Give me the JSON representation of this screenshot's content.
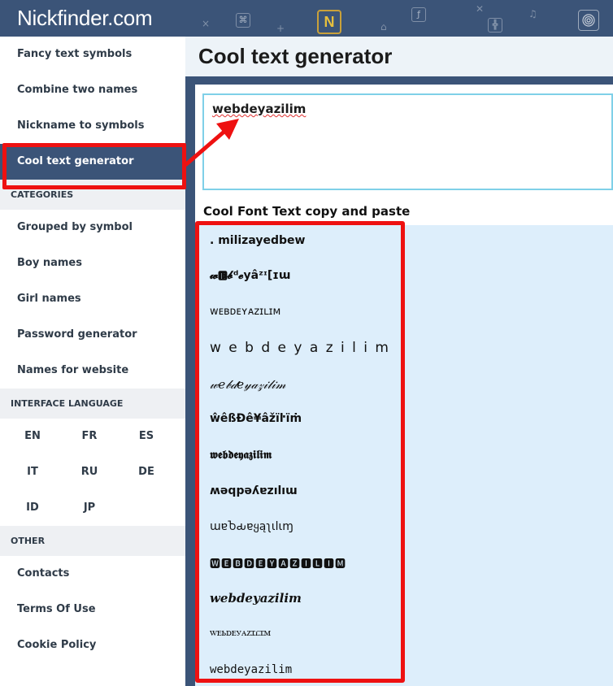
{
  "header": {
    "logo": "Nickfinder.com",
    "badge": "N",
    "deco": [
      "×",
      "⌘",
      "+",
      "ƒ",
      "✕",
      "╬",
      "♫",
      "⌂"
    ],
    "fingerprint_icon": "fingerprint-icon"
  },
  "sidebar": {
    "nav": [
      {
        "label": "Fancy text symbols"
      },
      {
        "label": "Combine two names"
      },
      {
        "label": "Nickname to symbols"
      },
      {
        "label": "Cool text generator"
      }
    ],
    "categories_heading": "CATEGORIES",
    "categories": [
      {
        "label": "Grouped by symbol"
      },
      {
        "label": "Boy names"
      },
      {
        "label": "Girl names"
      },
      {
        "label": "Password generator"
      },
      {
        "label": "Names for website"
      }
    ],
    "language_heading": "INTERFACE LANGUAGE",
    "languages": [
      "EN",
      "FR",
      "ES",
      "IT",
      "RU",
      "DE",
      "ID",
      "JP"
    ],
    "other_heading": "OTHER",
    "other": [
      {
        "label": "Contacts"
      },
      {
        "label": "Terms Of Use"
      },
      {
        "label": "Cookie Policy"
      }
    ]
  },
  "main": {
    "title": "Cool text generator",
    "input_value": "webdeyazilim",
    "results_heading": "Cool Font Text copy and paste",
    "results": [
      ". milizayedbew",
      "𝔀🅴𝓫ᵈ𝓮yâᶻᶦ[ɪɯ",
      "ᴡᴇʙᴅᴇʏᴀᴢɪʟɪᴍ",
      "w e b d e y a z i l i m",
      "𝓌𝑒𝒷𝒹𝑒𝓎𝒶𝓏𝒾𝓁𝒾𝓂",
      "ŵêßĐê¥âžïŀïṁ",
      "𝖜𝖊𝖇𝖉𝖊𝖞𝖆𝖟𝖎𝖑𝖎𝖒",
      "ʍǝqpǝʎɐzılıɯ",
      "ɯɐႦԃɐყąʅιlιɱ",
      "🆆🅴🅱🅳🅴🆈🅰🆉🅸🅻🅸🅼",
      "𝒘𝒆𝒃𝒅𝒆𝒚𝒂𝒛𝒊𝒍𝒊𝒎",
      "ꮃꭼꮟꭰꭼꭹꭺꮓꮖꮭꮖꮇ",
      "𝚠𝚎𝚋𝚍𝚎𝚢𝚊𝚣𝚒𝚕𝚒𝚖"
    ]
  },
  "colors": {
    "header_bg": "#3b5478",
    "active_bg": "#3b5478",
    "highlight_red": "#ee1111",
    "results_bg": "#ddeefb",
    "input_border": "#7fd0e8"
  }
}
